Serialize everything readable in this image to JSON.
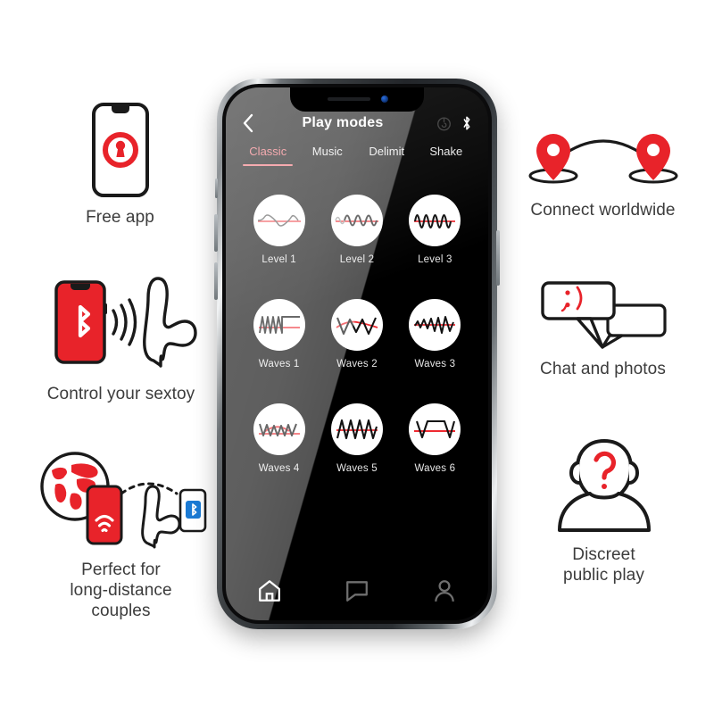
{
  "features_left": [
    {
      "id": "free-app",
      "caption": "Free app",
      "icon": "phone-lock-icon"
    },
    {
      "id": "control-sextoy",
      "caption": "Control your sextoy",
      "icon": "phone-bluetooth-waves-icon"
    },
    {
      "id": "long-distance",
      "caption": "Perfect for\nlong-distance\ncouples",
      "icon": "globe-phone-remote-icon"
    }
  ],
  "features_right": [
    {
      "id": "connect-worldwide",
      "caption": "Connect worldwide",
      "icon": "map-pins-arc-icon"
    },
    {
      "id": "chat-photos",
      "caption": "Chat and photos",
      "icon": "speech-bubbles-wink-icon"
    },
    {
      "id": "discreet-play",
      "caption": "Discreet\npublic play",
      "icon": "anonymous-person-question-icon"
    }
  ],
  "phone": {
    "appbar": {
      "back_icon": "chevron-left-icon",
      "title": "Play modes",
      "right_icons": [
        "power-dial-icon",
        "bluetooth-icon"
      ]
    },
    "tabs": [
      {
        "label": "Classic",
        "active": true
      },
      {
        "label": "Music",
        "active": false
      },
      {
        "label": "Delimit",
        "active": false
      },
      {
        "label": "Shake",
        "active": false
      }
    ],
    "modes": [
      {
        "label": "Level 1",
        "wave": "sine-low"
      },
      {
        "label": "Level 2",
        "wave": "sine-mid"
      },
      {
        "label": "Level 3",
        "wave": "sine-high"
      },
      {
        "label": "Waves 1",
        "wave": "zigzag-plateau"
      },
      {
        "label": "Waves 2",
        "wave": "triangle-big"
      },
      {
        "label": "Waves 3",
        "wave": "ramp-spike"
      },
      {
        "label": "Waves 4",
        "wave": "zigzag-arc"
      },
      {
        "label": "Waves 5",
        "wave": "triangle-dense"
      },
      {
        "label": "Waves 6",
        "wave": "trapezoid"
      }
    ],
    "navbar": [
      {
        "id": "home",
        "icon": "home-icon",
        "active": true
      },
      {
        "id": "chat",
        "icon": "chat-icon",
        "active": false
      },
      {
        "id": "profile",
        "icon": "profile-icon",
        "active": false
      }
    ]
  },
  "colors": {
    "brand_red": "#e8232a",
    "accent_pink": "#ef6a73",
    "wave_red": "#ee2a31",
    "caption_text": "#3c3c3c",
    "screen_bg": "#000000",
    "bluetooth_blue": "#1a7ad4"
  }
}
